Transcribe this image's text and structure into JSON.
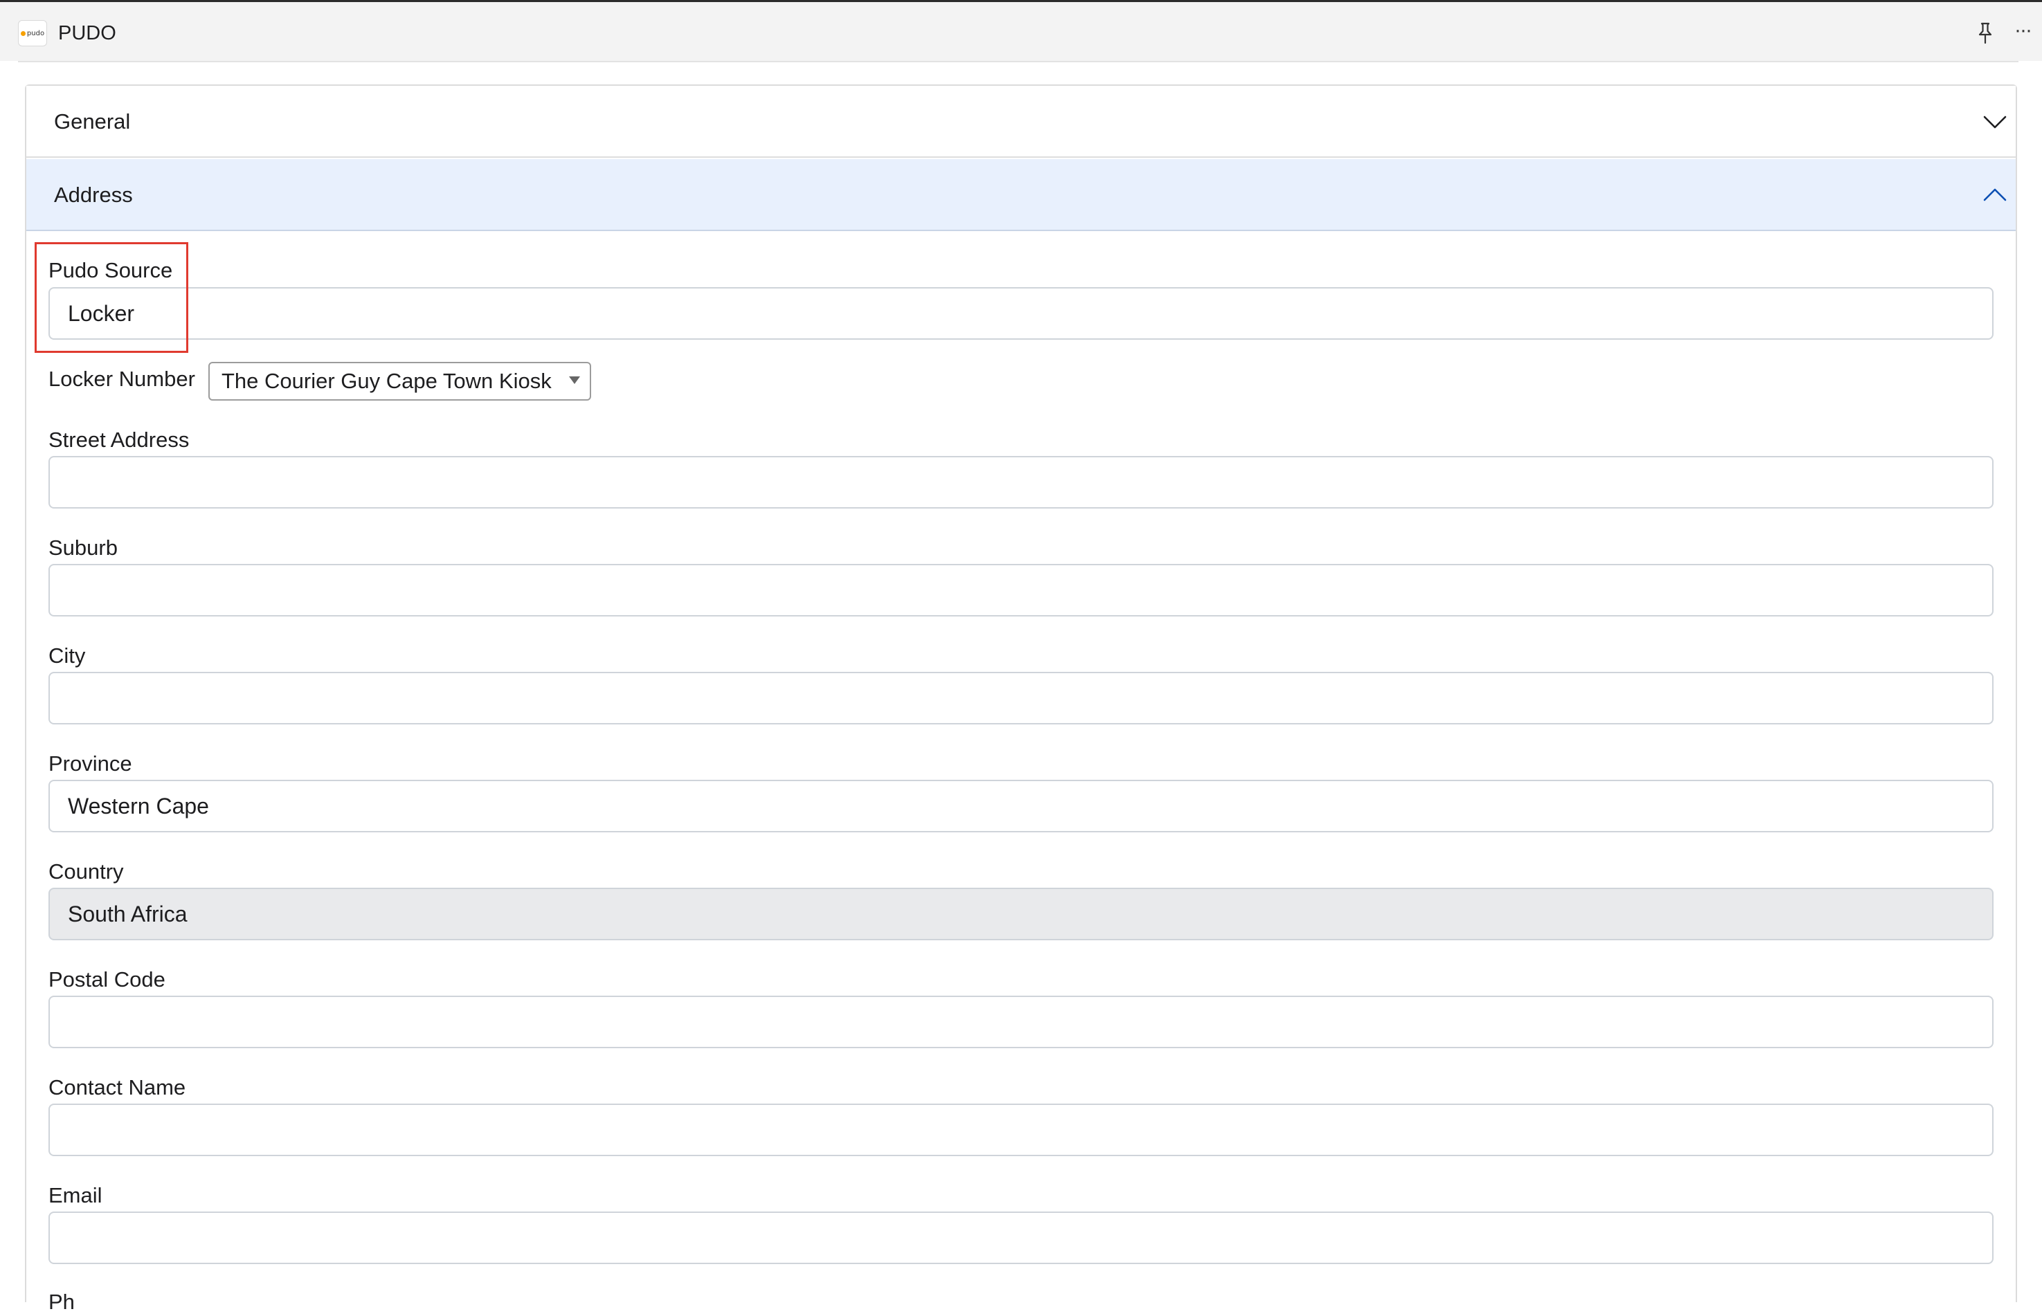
{
  "app": {
    "title": "PUDO",
    "logo_text": "pudo"
  },
  "accordion": {
    "general_label": "General",
    "address_label": "Address"
  },
  "form": {
    "pudo_source": {
      "label": "Pudo Source",
      "value": "Locker"
    },
    "locker_number": {
      "label": "Locker Number",
      "selected": "The Courier Guy Cape Town Kiosk"
    },
    "street_address": {
      "label": "Street Address",
      "value": ""
    },
    "suburb": {
      "label": "Suburb",
      "value": ""
    },
    "city": {
      "label": "City",
      "value": ""
    },
    "province": {
      "label": "Province",
      "value": "Western Cape"
    },
    "country": {
      "label": "Country",
      "value": "South Africa"
    },
    "postal_code": {
      "label": "Postal Code",
      "value": ""
    },
    "contact_name": {
      "label": "Contact Name",
      "value": ""
    },
    "email": {
      "label": "Email",
      "value": ""
    },
    "next_label_partial": "Ph"
  },
  "colors": {
    "accent_header_bg": "#e8f0fd",
    "highlight_border": "#e03a2f",
    "disabled_bg": "#e9eaec"
  },
  "icons": {
    "pin": "pin-icon",
    "more": "more-icon",
    "general_chevron": "chevron-down-icon",
    "address_chevron": "chevron-up-icon"
  }
}
